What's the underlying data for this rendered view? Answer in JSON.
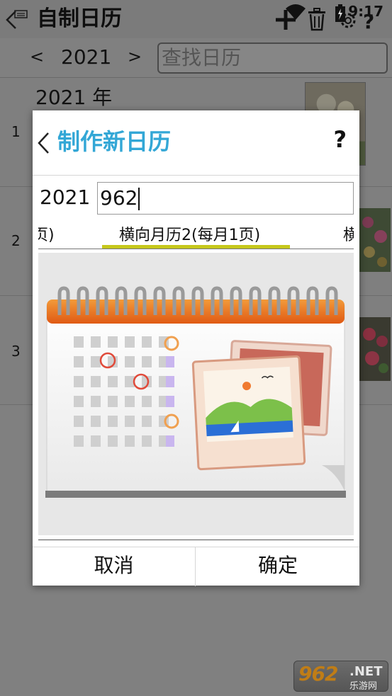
{
  "app": {
    "title": "自制日历",
    "time": "9:17"
  },
  "yearbar": {
    "prev": "<",
    "year": "2021",
    "next": ">",
    "search_placeholder": "查找日历"
  },
  "rows": [
    {
      "num": "1",
      "title": "2021 年"
    },
    {
      "num": "2"
    },
    {
      "num": "3"
    }
  ],
  "dialog": {
    "title": "制作新日历",
    "help": "?",
    "year": "2021",
    "input_value": "962",
    "tabs": {
      "left": "页)",
      "center": "横向月历2(每月1页)",
      "right": "横"
    },
    "cancel_label": "取消",
    "ok_label": "确定"
  },
  "watermark": {
    "number": "962",
    "net": ".NET",
    "sub": "乐游网"
  },
  "colors": {
    "dialog_title": "#33a7d6",
    "tab_indicator": "#c6c81b",
    "calendar_header": "#e8641c"
  }
}
